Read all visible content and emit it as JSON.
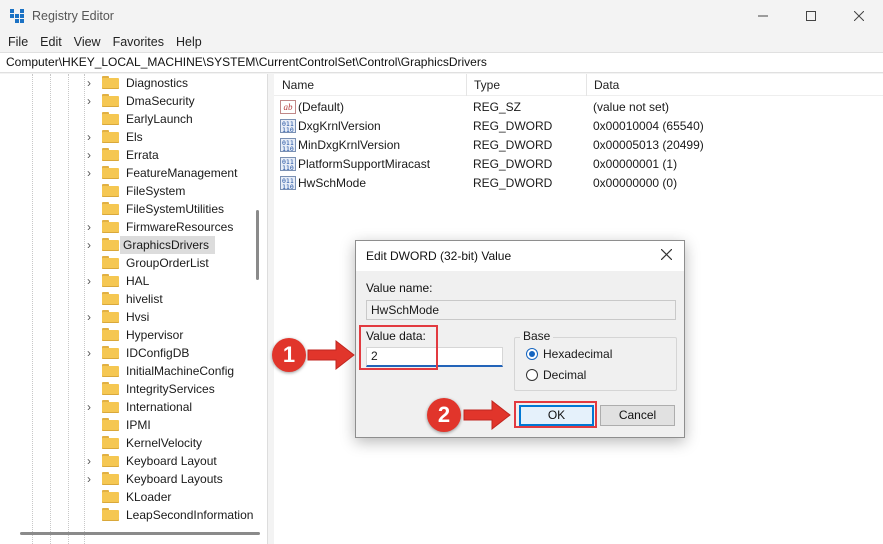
{
  "window": {
    "title": "Registry Editor",
    "controls": [
      "minimize",
      "maximize",
      "close"
    ]
  },
  "menu": [
    "File",
    "Edit",
    "View",
    "Favorites",
    "Help"
  ],
  "address": "Computer\\HKEY_LOCAL_MACHINE\\SYSTEM\\CurrentControlSet\\Control\\GraphicsDrivers",
  "tree": {
    "items": [
      {
        "label": "Diagnostics",
        "expandable": true
      },
      {
        "label": "DmaSecurity",
        "expandable": true
      },
      {
        "label": "EarlyLaunch",
        "expandable": false
      },
      {
        "label": "Els",
        "expandable": true
      },
      {
        "label": "Errata",
        "expandable": true
      },
      {
        "label": "FeatureManagement",
        "expandable": true
      },
      {
        "label": "FileSystem",
        "expandable": false
      },
      {
        "label": "FileSystemUtilities",
        "expandable": false
      },
      {
        "label": "FirmwareResources",
        "expandable": true
      },
      {
        "label": "GraphicsDrivers",
        "expandable": true,
        "selected": true
      },
      {
        "label": "GroupOrderList",
        "expandable": false
      },
      {
        "label": "HAL",
        "expandable": true
      },
      {
        "label": "hivelist",
        "expandable": false
      },
      {
        "label": "Hvsi",
        "expandable": true
      },
      {
        "label": "Hypervisor",
        "expandable": false
      },
      {
        "label": "IDConfigDB",
        "expandable": true
      },
      {
        "label": "InitialMachineConfig",
        "expandable": false
      },
      {
        "label": "IntegrityServices",
        "expandable": false
      },
      {
        "label": "International",
        "expandable": true
      },
      {
        "label": "IPMI",
        "expandable": false
      },
      {
        "label": "KernelVelocity",
        "expandable": false
      },
      {
        "label": "Keyboard Layout",
        "expandable": true
      },
      {
        "label": "Keyboard Layouts",
        "expandable": true
      },
      {
        "label": "KLoader",
        "expandable": false
      },
      {
        "label": "LeapSecondInformation",
        "expandable": false
      }
    ]
  },
  "values": {
    "headers": {
      "name": "Name",
      "type": "Type",
      "data": "Data"
    },
    "rows": [
      {
        "name": "(Default)",
        "type": "REG_SZ",
        "data": "(value not set)",
        "icon": "string-value-icon"
      },
      {
        "name": "DxgKrnlVersion",
        "type": "REG_DWORD",
        "data": "0x00010004 (65540)",
        "icon": "binary-value-icon"
      },
      {
        "name": "MinDxgKrnlVersion",
        "type": "REG_DWORD",
        "data": "0x00005013 (20499)",
        "icon": "binary-value-icon"
      },
      {
        "name": "PlatformSupportMiracast",
        "type": "REG_DWORD",
        "data": "0x00000001 (1)",
        "icon": "binary-value-icon"
      },
      {
        "name": "HwSchMode",
        "type": "REG_DWORD",
        "data": "0x00000000 (0)",
        "icon": "binary-value-icon"
      }
    ]
  },
  "dialog": {
    "title": "Edit DWORD (32-bit) Value",
    "value_name_label": "Value name:",
    "value_name": "HwSchMode",
    "value_data_label": "Value data:",
    "value_data": "2",
    "base_label": "Base",
    "radio_hex": "Hexadecimal",
    "radio_dec": "Decimal",
    "selected_base": "Hexadecimal",
    "ok": "OK",
    "cancel": "Cancel"
  },
  "annotations": {
    "step1": "1",
    "step2": "2",
    "highlight_color": "#e23a40",
    "badge_color": "#e1352b"
  }
}
